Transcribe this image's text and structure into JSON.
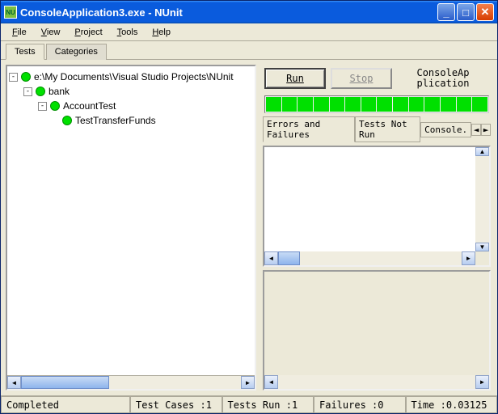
{
  "window": {
    "title": "ConsoleApplication3.exe - NUnit"
  },
  "menu": {
    "file": "File",
    "view": "View",
    "project": "Project",
    "tools": "Tools",
    "help": "Help"
  },
  "tabs": {
    "tests": "Tests",
    "categories": "Categories"
  },
  "tree": {
    "root": "e:\\My Documents\\Visual Studio Projects\\NUnit",
    "n1": "bank",
    "n2": "AccountTest",
    "n3": "TestTransferFunds"
  },
  "controls": {
    "run": "Run",
    "stop": "Stop",
    "app_label_1": "ConsoleAp",
    "app_label_2": "plication"
  },
  "result_tabs": {
    "t1": "Errors and Failures",
    "t2": "Tests Not Run",
    "t3": "Console."
  },
  "status": {
    "state": "Completed",
    "cases_label": "Test Cases : ",
    "cases": "1",
    "run_label": "Tests Run : ",
    "run": "1",
    "fail_label": "Failures : ",
    "fail": "0",
    "time_label": "Time : ",
    "time": "0.03125"
  }
}
